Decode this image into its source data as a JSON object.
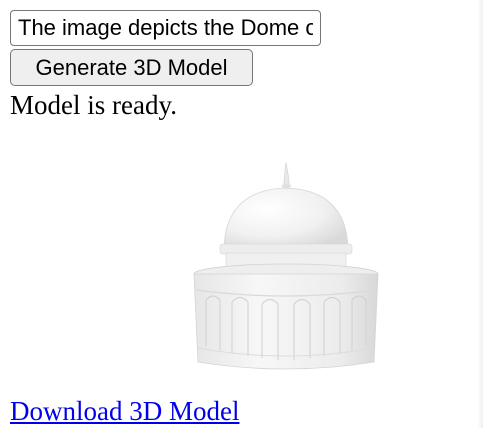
{
  "prompt": {
    "value": "The image depicts the Dome of the Rock"
  },
  "generate_button": {
    "label": "Generate 3D Model"
  },
  "status": {
    "text": "Model is ready."
  },
  "download": {
    "label": "Download 3D Model"
  },
  "model_preview": {
    "subject": "dome-building",
    "color": "#f2f2f2"
  }
}
